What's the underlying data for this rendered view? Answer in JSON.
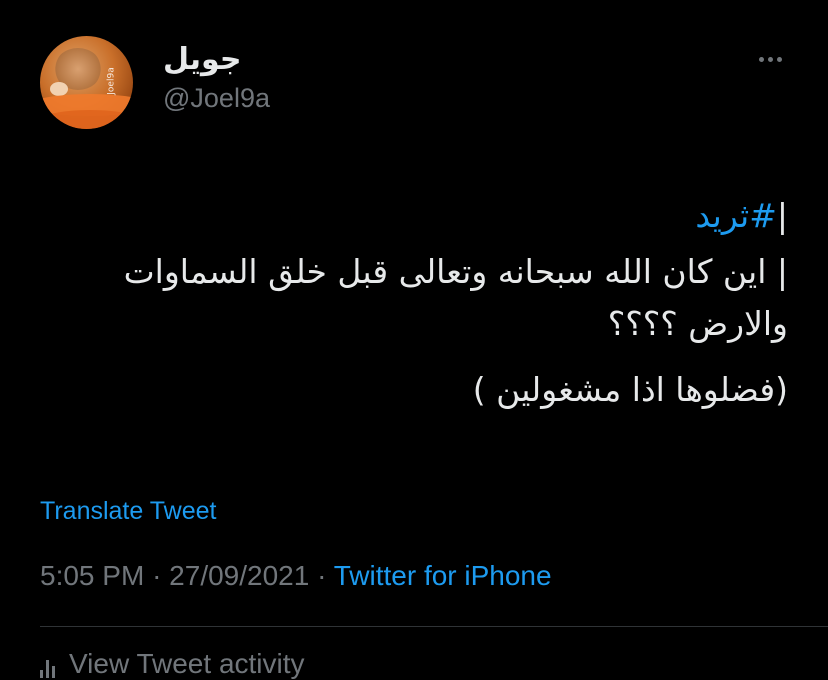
{
  "author": {
    "display_name": "جويل",
    "handle": "@Joel9a",
    "avatar_watermark": "Joel9a"
  },
  "tweet": {
    "hashtag_prefix": "|",
    "hashtag": "#ثريد",
    "lines": [
      "| اين كان الله سبحانه وتعالى قبل خلق السماوات",
      "والارض ؟؟؟؟"
    ],
    "footer_line": "(فضلوها اذا مشغولين )"
  },
  "translate_label": "Translate Tweet",
  "meta": {
    "time": "5:05 PM",
    "separator": "·",
    "date": "27/09/2021",
    "source": "Twitter for iPhone"
  },
  "activity_label": "View Tweet activity",
  "icons": {
    "more": "more-icon",
    "activity": "bar-chart-icon"
  },
  "colors": {
    "background": "#000000",
    "text": "#e7e9ea",
    "muted": "#71767b",
    "accent": "#1d9bf0"
  }
}
